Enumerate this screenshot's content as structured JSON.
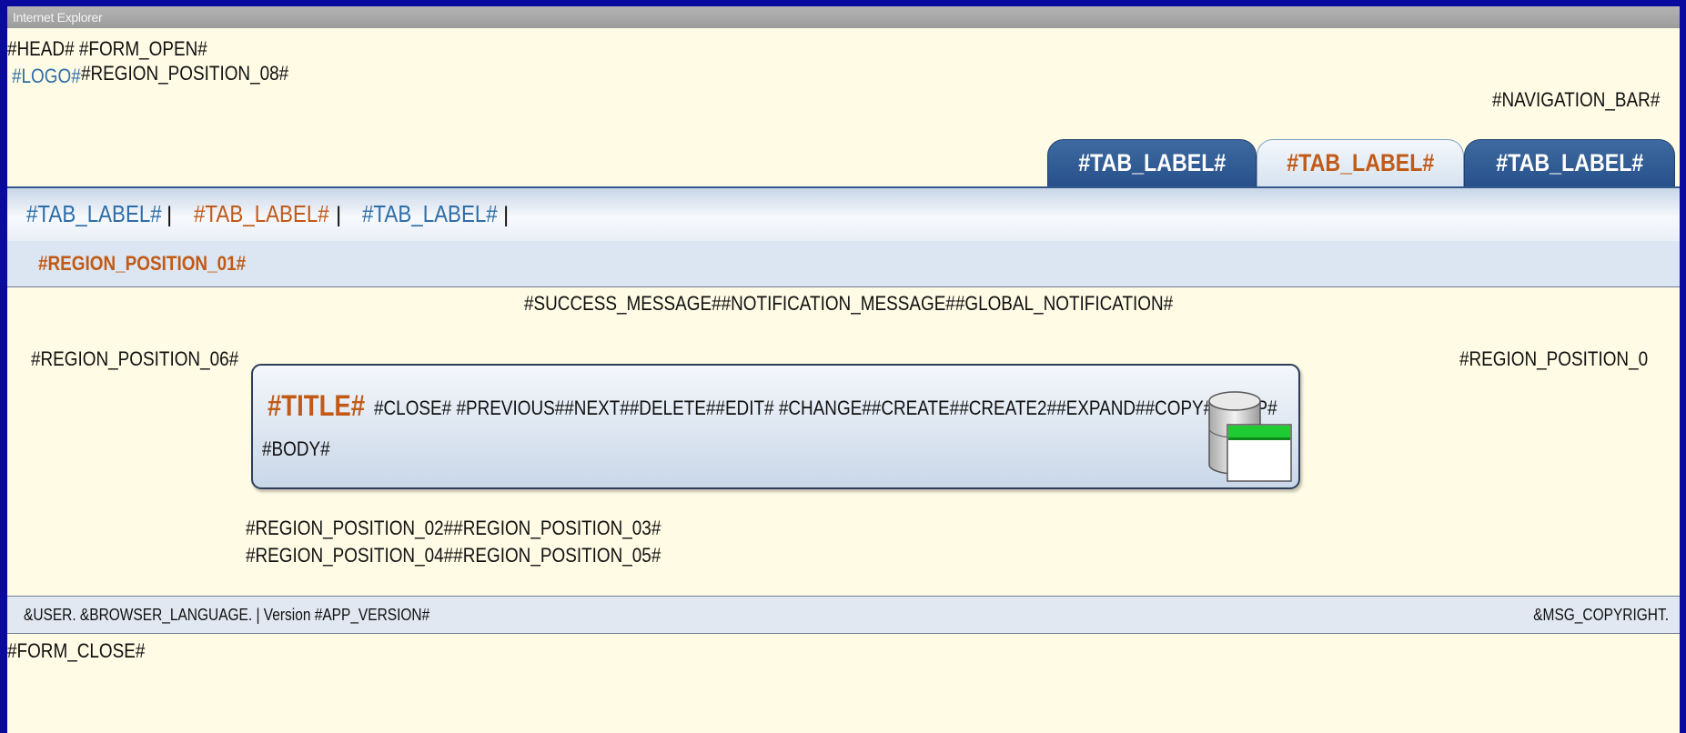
{
  "window": {
    "title": "Internet Explorer"
  },
  "header": {
    "head_form_open": "#HEAD# #FORM_OPEN#",
    "logo": "#LOGO#",
    "region_position_08": "#REGION_POSITION_08#",
    "navigation_bar": "#NAVIGATION_BAR#"
  },
  "tabs": [
    {
      "label": "#TAB_LABEL#",
      "active": false
    },
    {
      "label": "#TAB_LABEL#",
      "active": true
    },
    {
      "label": "#TAB_LABEL#",
      "active": false
    }
  ],
  "subnav": {
    "items": [
      {
        "label": "#TAB_LABEL#",
        "active": false
      },
      {
        "label": "#TAB_LABEL#",
        "active": true
      },
      {
        "label": "#TAB_LABEL#",
        "active": false
      }
    ],
    "separator": "|"
  },
  "regions": {
    "region_position_01": "#REGION_POSITION_01#",
    "messages": "#SUCCESS_MESSAGE##NOTIFICATION_MESSAGE##GLOBAL_NOTIFICATION#",
    "region_position_06": "#REGION_POSITION_06#",
    "region_position_right": "#REGION_POSITION_0",
    "region_02_03": "#REGION_POSITION_02##REGION_POSITION_03#",
    "region_04_05": "#REGION_POSITION_04##REGION_POSITION_05#"
  },
  "panel": {
    "title": "#TITLE#",
    "actions": "#CLOSE#  #PREVIOUS##NEXT##DELETE##EDIT# #CHANGE##CREATE##CREATE2##EXPAND##COPY##HELP#",
    "body": "#BODY#",
    "icon": "database-icon"
  },
  "footer": {
    "left": "&USER.   &BROWSER_LANGUAGE. | Version #APP_VERSION#",
    "right": "&MSG_COPYRIGHT."
  },
  "form_close": "#FORM_CLOSE#",
  "colors": {
    "frame": "#0a0a9e",
    "page_background": "#fffbe5",
    "accent_orange": "#c15a17",
    "link_blue": "#2e6ea8",
    "tab_blue": "#27508a"
  }
}
